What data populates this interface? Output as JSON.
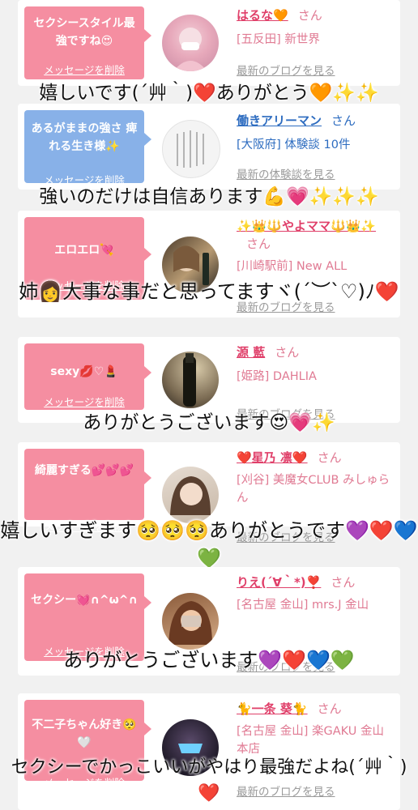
{
  "cards": [
    {
      "bubble_text": "セクシースタイル最強ですね😍",
      "delete_label": "メッセージを削除",
      "name": "はるな🧡",
      "san": "さん",
      "shop": "[五反田] 新世界",
      "link": "最新のブログを見る",
      "overlay": "嬉しいです(´艸｀)❤️ありがとう🧡✨✨"
    },
    {
      "bubble_text": "あるがままの強さ 痺れる生き様✨",
      "delete_label": "メッセージを削除",
      "name": "働きアリーマン",
      "san": "さん",
      "shop": "[大阪府] 体験談 10件",
      "link": "最新の体験談を見る",
      "overlay": "強いのだけは自信あります💪💗✨✨✨"
    },
    {
      "bubble_text": "エロエロ💘",
      "delete_label": "メッセージを削除",
      "name": "✨👑🔱やよママ🔱👑✨",
      "san": "さん",
      "shop": "[川崎駅前] New ALL",
      "link": "最新のブログを見る",
      "overlay": "姉👩大事な事だと思ってますヾ(´︶`♡)ﾉ❤️"
    },
    {
      "bubble_text": "sexy💋♡💄",
      "delete_label": "メッセージを削除",
      "name": "源 藍",
      "san": "さん",
      "shop": "[姫路] DAHLIA",
      "link": "最新のブログを見る",
      "overlay": "ありがとうございます😍💗✨"
    },
    {
      "bubble_text": "綺麗すぎる💕💕💕",
      "delete_label": "メッセージを削除",
      "name": "❤️星乃 凛❤️",
      "san": "さん",
      "shop": "[刈谷] 美魔女CLUB みしゅらん",
      "link": "最新のブログを見る",
      "overlay": "嬉しいすぎます🥺🥺🥺ありがとうです💜❤️💙💚"
    },
    {
      "bubble_text": "セクシー💓∩^ω^∩",
      "delete_label": "メッセージを削除",
      "name": "りえ(´∀｀*)❣️",
      "san": "さん",
      "shop": "[名古屋 金山] mrs.J 金山",
      "link": "最新のブログを見る",
      "overlay": "ありがとうございます💜❤️💙💚"
    },
    {
      "bubble_text": "不二子ちゃん好き🥺🤍",
      "delete_label": "メッセージを削除",
      "name": "🐈一条 葵🐈",
      "san": "さん",
      "shop": "[名古屋 金山] 楽GAKU 金山本店",
      "link": "最新のブログを見る",
      "overlay": "セクシーでかっこいいがやはり最強だよね(´艸｀)❤️"
    }
  ],
  "colors": {
    "bubble_pink": "#f58ea1",
    "bubble_blue": "#88b1e8",
    "name_pink": "#e0406a",
    "name_blue": "#2d6cc0",
    "shop_pink": "#e07a93",
    "link_gray": "#9a9a9a"
  }
}
